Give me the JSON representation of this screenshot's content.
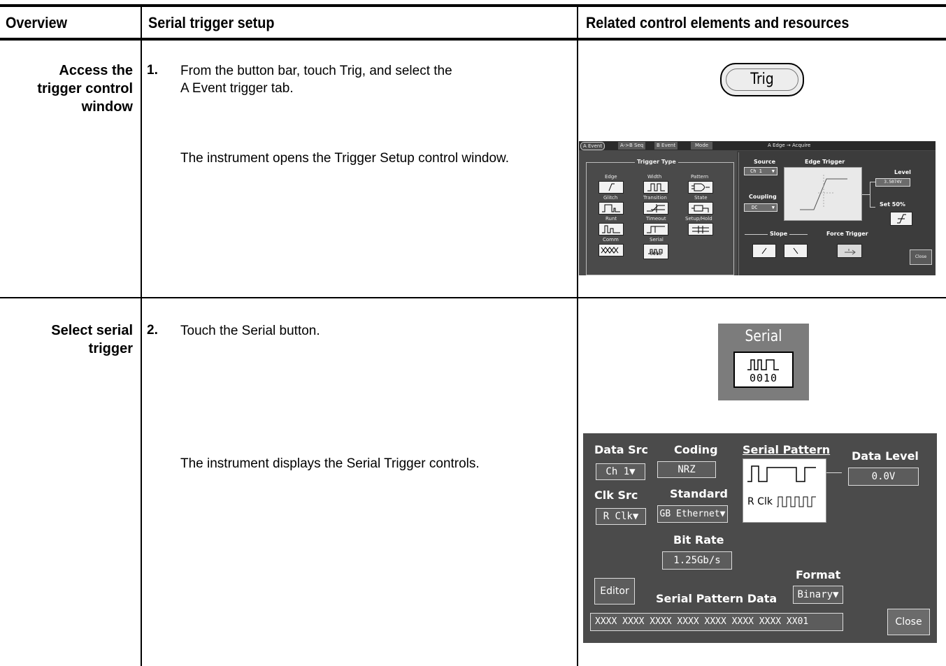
{
  "columns": {
    "overview": "Overview",
    "setup": "Serial trigger setup",
    "related": "Related control elements and resources"
  },
  "rows": [
    {
      "label_lines": [
        "Access the",
        "trigger control",
        "window"
      ],
      "number": "1.",
      "text_lines": [
        "From the button bar, touch Trig, and select the",
        "A Event trigger tab."
      ],
      "result": "The instrument opens the Trigger Setup control window."
    },
    {
      "label_lines": [
        "Select serial",
        "trigger"
      ],
      "number": "2.",
      "text": "Touch the Serial button.",
      "result": "The instrument displays the Serial Trigger controls."
    }
  ],
  "trig_button": {
    "label": "Trig"
  },
  "trigger_window": {
    "tabs": [
      "A Event",
      "A->B Seq",
      "B Event",
      "Mode"
    ],
    "status": "A Edge → Acquire",
    "trigger_type_title": "Trigger Type",
    "types": [
      "Edge",
      "Width",
      "Pattern",
      "Glitch",
      "Transition",
      "State",
      "Runt",
      "Timeout",
      "Setup/Hold",
      "Comm",
      "Serial"
    ],
    "serial_bits": "0010",
    "source_label": "Source",
    "source_value": "Ch 1",
    "coupling_label": "Coupling",
    "coupling_value": "DC",
    "edge_trigger_label": "Edge Trigger",
    "level_label": "Level",
    "level_value": "3.5074V",
    "set50_label": "Set 50%",
    "slope_label": "Slope",
    "force_label": "Force Trigger",
    "close_label": "Close"
  },
  "serial_button": {
    "label": "Serial",
    "bits": "0010"
  },
  "serial_panel": {
    "data_src_label": "Data Src",
    "data_src_value": "Ch 1",
    "coding_label": "Coding",
    "coding_value": "NRZ",
    "serial_pattern_label": "Serial Pattern",
    "rclk_label": "R Clk",
    "data_level_label": "Data Level",
    "data_level_value": "0.0V",
    "clk_src_label": "Clk Src",
    "clk_src_value": "R Clk",
    "standard_label": "Standard",
    "standard_value": "GB Ethernet",
    "bit_rate_label": "Bit Rate",
    "bit_rate_value": "1.25Gb/s",
    "format_label": "Format",
    "format_value": "Binary",
    "editor_label": "Editor",
    "pattern_data_label": "Serial Pattern Data",
    "pattern_data_value": "XXXX XXXX XXXX XXXX XXXX XXXX XXXX XX01",
    "close_label": "Close"
  }
}
